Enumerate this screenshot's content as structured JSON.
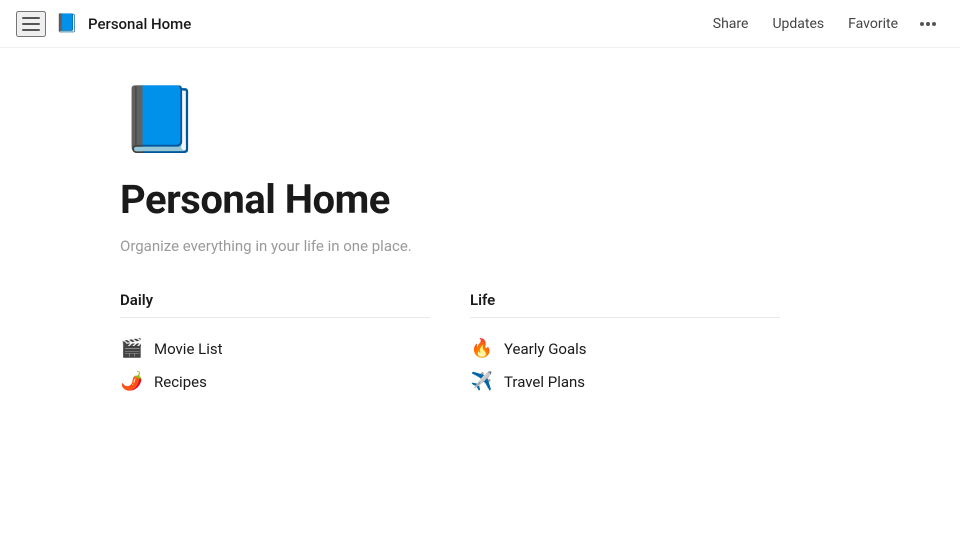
{
  "header": {
    "title": "Personal Home",
    "share_label": "Share",
    "updates_label": "Updates",
    "favorite_label": "Favorite"
  },
  "page": {
    "cover_icon": "📘",
    "title": "Personal Home",
    "description": "Organize everything in your life in one place."
  },
  "daily": {
    "title": "Daily",
    "items": [
      {
        "emoji": "🎬",
        "label": "Movie List"
      },
      {
        "emoji": "🌶️",
        "label": "Recipes"
      }
    ]
  },
  "life": {
    "title": "Life",
    "items": [
      {
        "emoji": "🔥",
        "label": "Yearly Goals"
      },
      {
        "emoji": "✈️",
        "label": "Travel Plans"
      }
    ]
  }
}
